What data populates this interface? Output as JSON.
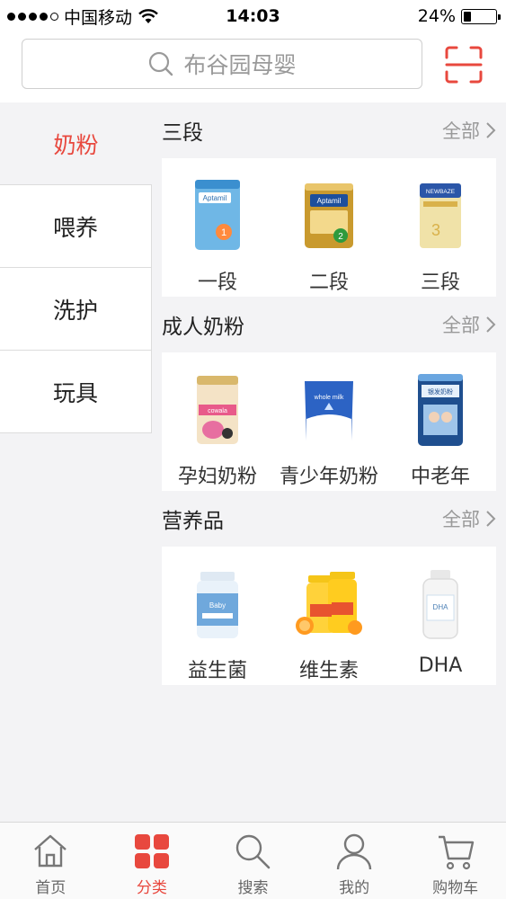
{
  "status": {
    "carrier": "中国移动",
    "time": "14:03",
    "battery": "24%",
    "battery_level": 0.24
  },
  "search": {
    "placeholder": "布谷园母婴"
  },
  "sidebar": {
    "items": [
      {
        "label": "奶粉",
        "active": true
      },
      {
        "label": "喂养",
        "active": false
      },
      {
        "label": "洗护",
        "active": false
      },
      {
        "label": "玩具",
        "active": false
      }
    ]
  },
  "sections": [
    {
      "title": "三段",
      "all_label": "全部",
      "products": [
        {
          "label": "一段",
          "icon": "aptamil-stage1-can"
        },
        {
          "label": "二段",
          "icon": "aptamil-gold-stage2-can"
        },
        {
          "label": "三段",
          "icon": "newbaze-stage3-can"
        }
      ]
    },
    {
      "title": "成人奶粉",
      "all_label": "全部",
      "products": [
        {
          "label": "孕妇奶粉",
          "icon": "maternal-milk-can"
        },
        {
          "label": "青少年奶粉",
          "icon": "teen-milk-bag"
        },
        {
          "label": "中老年",
          "icon": "senior-milk-can"
        }
      ]
    },
    {
      "title": "营养品",
      "all_label": "全部",
      "products": [
        {
          "label": "益生菌",
          "icon": "probiotic-bottle"
        },
        {
          "label": "维生素",
          "icon": "vitamin-jars"
        },
        {
          "label": "DHA",
          "icon": "dha-bottle"
        }
      ]
    }
  ],
  "tabbar": {
    "items": [
      {
        "label": "首页",
        "icon": "home-icon",
        "active": false
      },
      {
        "label": "分类",
        "icon": "category-icon",
        "active": true
      },
      {
        "label": "搜索",
        "icon": "search-icon",
        "active": false
      },
      {
        "label": "我的",
        "icon": "user-icon",
        "active": false
      },
      {
        "label": "购物车",
        "icon": "cart-icon",
        "active": false
      }
    ]
  },
  "colors": {
    "accent": "#e8483e",
    "background": "#f3f3f5"
  }
}
